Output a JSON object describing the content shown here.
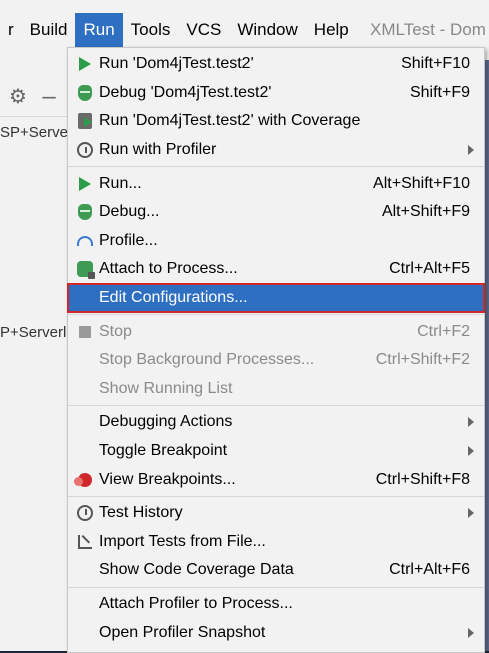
{
  "menubar": {
    "items": [
      "r",
      "Build",
      "Run",
      "Tools",
      "VCS",
      "Window",
      "Help"
    ],
    "window_title": "XMLTest - Dom"
  },
  "left_panel": {
    "tree_item_1": "SP+Serve",
    "tree_item_2": "P+Serverl"
  },
  "run_menu": {
    "groups": [
      [
        {
          "label": "Run 'Dom4jTest.test2'",
          "shortcut": "Shift+F10",
          "icon": "run-icon"
        },
        {
          "label": "Debug 'Dom4jTest.test2'",
          "shortcut": "Shift+F9",
          "icon": "debug-icon"
        },
        {
          "label": "Run 'Dom4jTest.test2' with Coverage",
          "shortcut": "",
          "icon": "coverage-icon"
        },
        {
          "label": "Run with Profiler",
          "shortcut": "",
          "icon": "profiler-icon",
          "submenu": true
        }
      ],
      [
        {
          "label": "Run...",
          "shortcut": "Alt+Shift+F10",
          "icon": "run-icon"
        },
        {
          "label": "Debug...",
          "shortcut": "Alt+Shift+F9",
          "icon": "debug-icon"
        },
        {
          "label": "Profile...",
          "shortcut": "",
          "icon": "gauge-icon"
        },
        {
          "label": "Attach to Process...",
          "shortcut": "Ctrl+Alt+F5",
          "icon": "attach-icon"
        },
        {
          "label": "Edit Configurations...",
          "shortcut": "",
          "icon": "",
          "selected": true
        }
      ],
      [
        {
          "label": "Stop",
          "shortcut": "Ctrl+F2",
          "icon": "stop-icon",
          "disabled": true
        },
        {
          "label": "Stop Background Processes...",
          "shortcut": "Ctrl+Shift+F2",
          "icon": "",
          "disabled": true
        },
        {
          "label": "Show Running List",
          "shortcut": "",
          "icon": "",
          "disabled": true
        }
      ],
      [
        {
          "label": "Debugging Actions",
          "shortcut": "",
          "icon": "",
          "submenu": true
        },
        {
          "label": "Toggle Breakpoint",
          "shortcut": "",
          "icon": "",
          "submenu": true
        },
        {
          "label": "View Breakpoints...",
          "shortcut": "Ctrl+Shift+F8",
          "icon": "breakpoints-icon"
        }
      ],
      [
        {
          "label": "Test History",
          "shortcut": "",
          "icon": "history-icon",
          "submenu": true
        },
        {
          "label": "Import Tests from File...",
          "shortcut": "",
          "icon": "import-icon"
        },
        {
          "label": "Show Code Coverage Data",
          "shortcut": "Ctrl+Alt+F6",
          "icon": ""
        }
      ],
      [
        {
          "label": "Attach Profiler to Process...",
          "shortcut": "",
          "icon": ""
        },
        {
          "label": "Open Profiler Snapshot",
          "shortcut": "",
          "icon": "",
          "submenu": true
        }
      ]
    ]
  },
  "colors": {
    "selected_bg": "#2f6fc2",
    "highlight_border": "#d0282a",
    "run_green": "#2e9d4a"
  }
}
